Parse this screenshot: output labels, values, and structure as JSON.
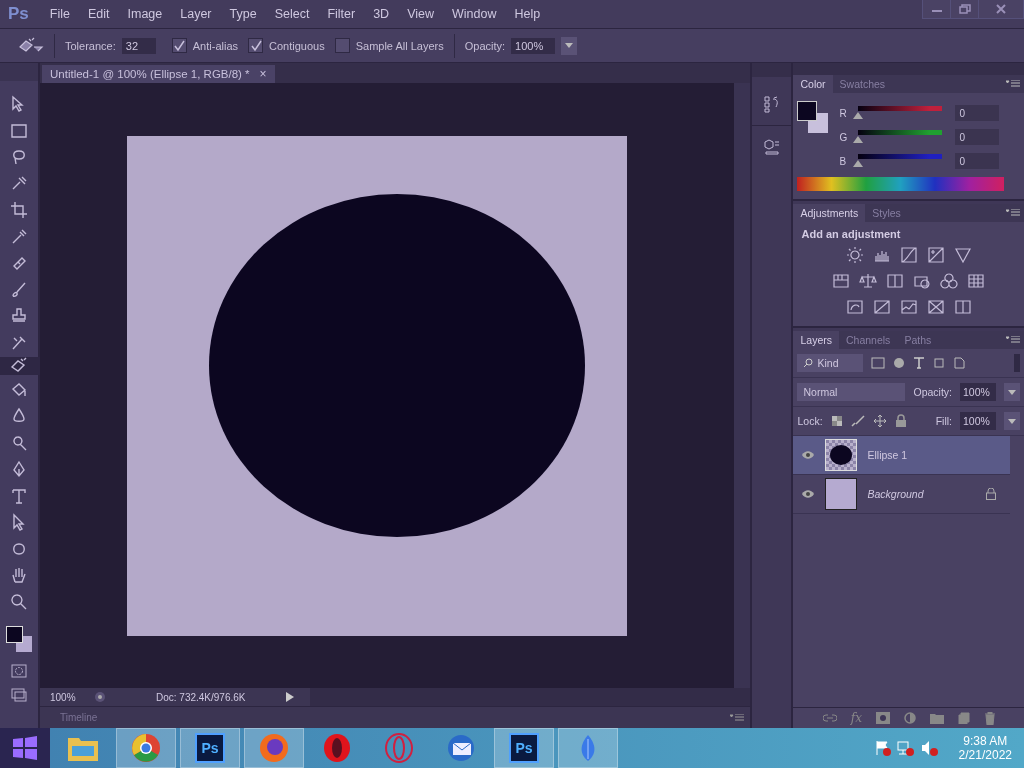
{
  "app": {
    "logo": "Ps"
  },
  "menu": [
    "File",
    "Edit",
    "Image",
    "Layer",
    "Type",
    "Select",
    "Filter",
    "3D",
    "View",
    "Window",
    "Help"
  ],
  "options": {
    "tolerance_label": "Tolerance:",
    "tolerance": "32",
    "checkboxes": [
      {
        "label": "Anti-alias",
        "checked": true
      },
      {
        "label": "Contiguous",
        "checked": true
      },
      {
        "label": "Sample All Layers",
        "checked": false
      }
    ],
    "opacity_label": "Opacity:",
    "opacity": "100%"
  },
  "document_tab": {
    "title": "Untitled-1 @ 100% (Ellipse 1, RGB/8) *",
    "close": "×"
  },
  "tools": [
    {
      "kind": "move",
      "selected": false
    },
    {
      "kind": "marquee",
      "selected": false
    },
    {
      "kind": "lasso",
      "selected": false
    },
    {
      "kind": "quick",
      "selected": false
    },
    {
      "kind": "crop",
      "selected": false
    },
    {
      "kind": "dropper",
      "selected": false
    },
    {
      "kind": "heal",
      "selected": false
    },
    {
      "kind": "brush",
      "selected": false
    },
    {
      "kind": "stamp",
      "selected": false
    },
    {
      "kind": "history",
      "selected": false
    },
    {
      "kind": "eraser",
      "selected": true
    },
    {
      "kind": "bucket",
      "selected": false
    },
    {
      "kind": "blur",
      "selected": false
    },
    {
      "kind": "dodge",
      "selected": false
    },
    {
      "kind": "pen",
      "selected": false
    },
    {
      "kind": "type",
      "selected": false
    },
    {
      "kind": "arrow",
      "selected": false
    },
    {
      "kind": "ellipse",
      "selected": false
    },
    {
      "kind": "hand",
      "selected": false
    },
    {
      "kind": "zoom",
      "selected": false
    }
  ],
  "status_bar": {
    "zoom": "100%",
    "doc": "Doc: 732.4K/976.6K"
  },
  "timeline": {
    "label": "Timeline"
  },
  "color_panel": {
    "tabs": [
      {
        "label": "Color",
        "selected": true
      },
      {
        "label": "Swatches",
        "selected": false
      }
    ],
    "channels": [
      {
        "name": "R",
        "value": "0",
        "level": 0,
        "color": "#c0203c"
      },
      {
        "name": "G",
        "value": "0",
        "level": 0,
        "color": "#20a030"
      },
      {
        "name": "B",
        "value": "0",
        "level": 0,
        "color": "#2020c0"
      }
    ]
  },
  "adjustments_panel": {
    "tabs": [
      {
        "label": "Adjustments",
        "selected": true
      },
      {
        "label": "Styles",
        "selected": false
      }
    ],
    "heading": "Add an adjustment",
    "rows": [
      [
        {
          "kind": "sun"
        },
        {
          "kind": "histogram"
        },
        {
          "kind": "curve"
        },
        {
          "kind": "exposure"
        },
        {
          "kind": "triangle"
        }
      ],
      [
        {
          "kind": "bars"
        },
        {
          "kind": "scales"
        },
        {
          "kind": "half"
        },
        {
          "kind": "camera"
        },
        {
          "kind": "circles"
        },
        {
          "kind": "grid"
        }
      ],
      [
        {
          "kind": "swirl"
        },
        {
          "kind": "diag"
        },
        {
          "kind": "wave"
        },
        {
          "kind": "cross"
        },
        {
          "kind": "gradient"
        }
      ]
    ]
  },
  "layers_panel": {
    "tabs": [
      {
        "label": "Layers",
        "selected": true
      },
      {
        "label": "Channels",
        "selected": false
      },
      {
        "label": "Paths",
        "selected": false
      }
    ],
    "filter": "Kind",
    "blend_mode": "Normal",
    "opacity_label": "Opacity:",
    "opacity": "100%",
    "lock_label": "Lock:",
    "fill_label": "Fill:",
    "fill": "100%",
    "layers": [
      {
        "name": "Ellipse 1",
        "kind": "shape",
        "selected": true,
        "visible": true,
        "locked": false
      },
      {
        "name": "Background",
        "kind": "background",
        "selected": false,
        "visible": true,
        "locked": true
      }
    ],
    "fx_label": "fx"
  },
  "taskbar": {
    "apps": [
      {
        "kind": "folder",
        "highlighted": false
      },
      {
        "kind": "chrome",
        "highlighted": true
      },
      {
        "kind": "ps",
        "label": "Ps",
        "highlighted": true
      },
      {
        "kind": "firefox",
        "highlighted": true
      },
      {
        "kind": "opera",
        "highlighted": false
      },
      {
        "kind": "ring",
        "highlighted": false
      },
      {
        "kind": "mail",
        "highlighted": false
      },
      {
        "kind": "ps",
        "label": "Ps",
        "highlighted": true
      },
      {
        "kind": "leaf",
        "highlighted": true
      }
    ],
    "time": "9:38 AM",
    "date": "2/21/2022"
  }
}
